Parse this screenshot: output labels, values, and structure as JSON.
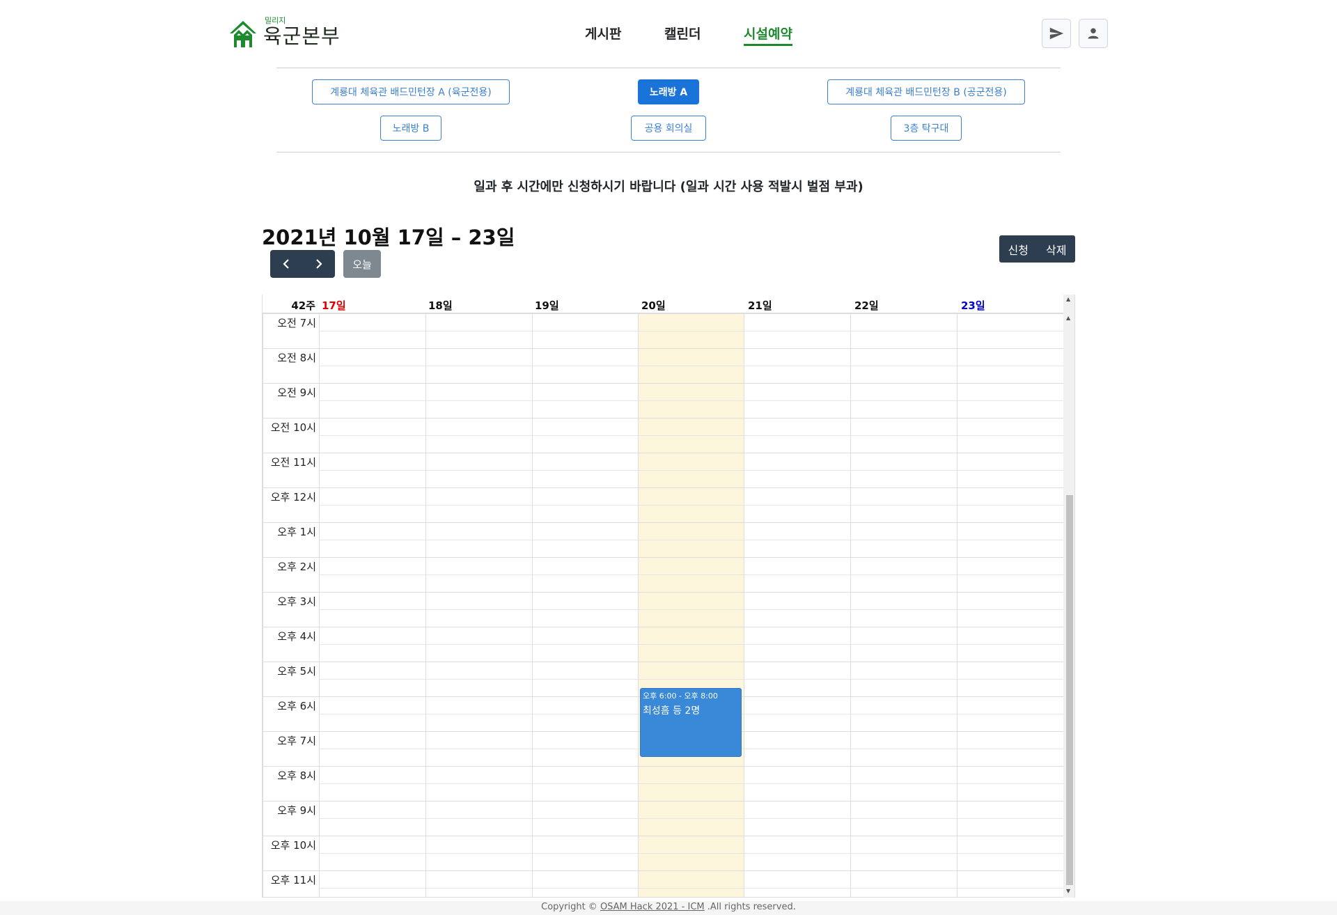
{
  "header": {
    "logo_small": "밀리지",
    "logo_main": "육군본부",
    "nav": [
      {
        "label": "게시판",
        "active": false
      },
      {
        "label": "캘린더",
        "active": false
      },
      {
        "label": "시설예약",
        "active": true
      }
    ],
    "icons": [
      "send-icon",
      "user-icon"
    ]
  },
  "facilities": [
    {
      "label": "계룡대 체육관 배드민턴장 A (육군전용)",
      "active": false
    },
    {
      "label": "노래방 A",
      "active": true
    },
    {
      "label": "계룡대 체육관 배드민턴장 B (공군전용)",
      "active": false
    },
    {
      "label": "노래방 B",
      "active": false
    },
    {
      "label": "공용 회의실",
      "active": false
    },
    {
      "label": "3층 탁구대",
      "active": false
    }
  ],
  "notice": "일과 후 시간에만 신청하시기 바랍니다 (일과 시간 사용 적발시 벌점 부과)",
  "toolbar": {
    "range_title": "2021년 10월 17일 – 23일",
    "today_label": "오늘",
    "apply_label": "신청",
    "delete_label": "삭제"
  },
  "calendar": {
    "week_label": "42주",
    "days": [
      {
        "label": "17일",
        "color": "#e00000"
      },
      {
        "label": "18일",
        "color": "#111111"
      },
      {
        "label": "19일",
        "color": "#111111"
      },
      {
        "label": "20일",
        "color": "#111111"
      },
      {
        "label": "21일",
        "color": "#111111"
      },
      {
        "label": "22일",
        "color": "#111111"
      },
      {
        "label": "23일",
        "color": "#0000d0"
      }
    ],
    "hours": [
      "오전 7시",
      "오전 8시",
      "오전 9시",
      "오전 10시",
      "오전 11시",
      "오후 12시",
      "오후 1시",
      "오후 2시",
      "오후 3시",
      "오후 4시",
      "오후 5시",
      "오후 6시",
      "오후 7시",
      "오후 8시",
      "오후 9시",
      "오후 10시",
      "오후 11시"
    ],
    "event": {
      "time": "오후 6:00 - 오후 8:00",
      "title": "최성흠 등 2명"
    }
  },
  "footer": {
    "prefix": "Copyright © ",
    "link": "OSAM Hack 2021 - ICM",
    "suffix": " .All rights reserved."
  }
}
